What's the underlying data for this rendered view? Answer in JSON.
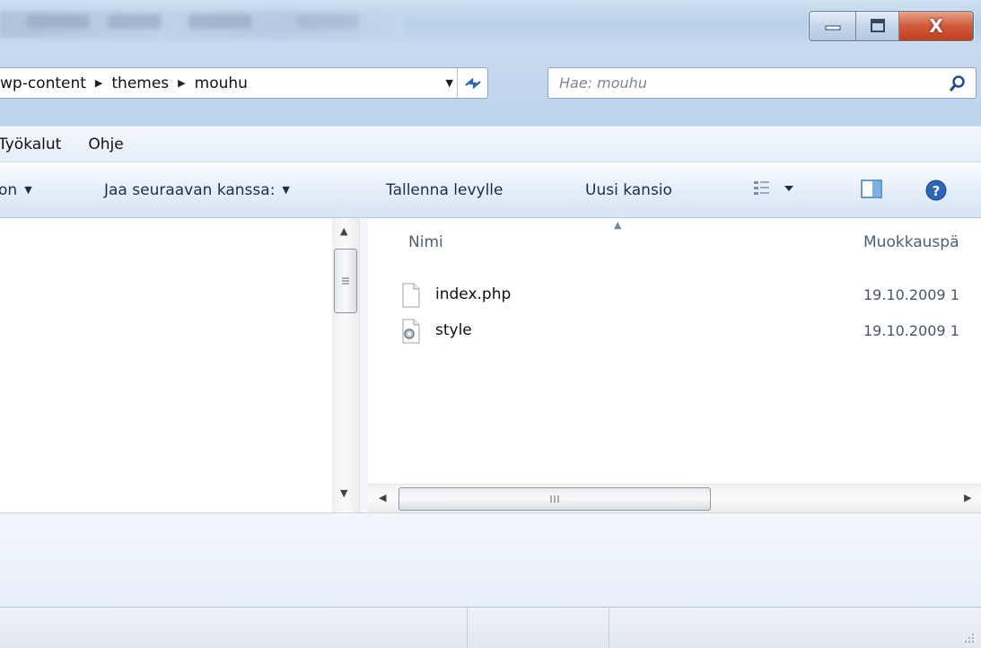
{
  "titlebar": {
    "close_symbol": "X"
  },
  "address": {
    "crumbs": [
      "wp-content",
      "themes",
      "mouhu"
    ]
  },
  "search": {
    "placeholder": "Hae: mouhu"
  },
  "menu": {
    "items": [
      "Työkalut",
      "Ohje"
    ]
  },
  "commands": {
    "organize_partial": "on",
    "share": "Jaa seuraavan kanssa:",
    "burn": "Tallenna levylle",
    "new_folder": "Uusi kansio"
  },
  "columns": {
    "name": "Nimi",
    "modified": "Muokkauspä"
  },
  "files": [
    {
      "name": "index.php",
      "date": "19.10.2009 1",
      "icon": "blank-file-icon"
    },
    {
      "name": "style",
      "date": "19.10.2009 1",
      "icon": "css-file-icon"
    }
  ],
  "colors": {
    "accent": "#2a66b5",
    "close": "#c94a2b"
  }
}
